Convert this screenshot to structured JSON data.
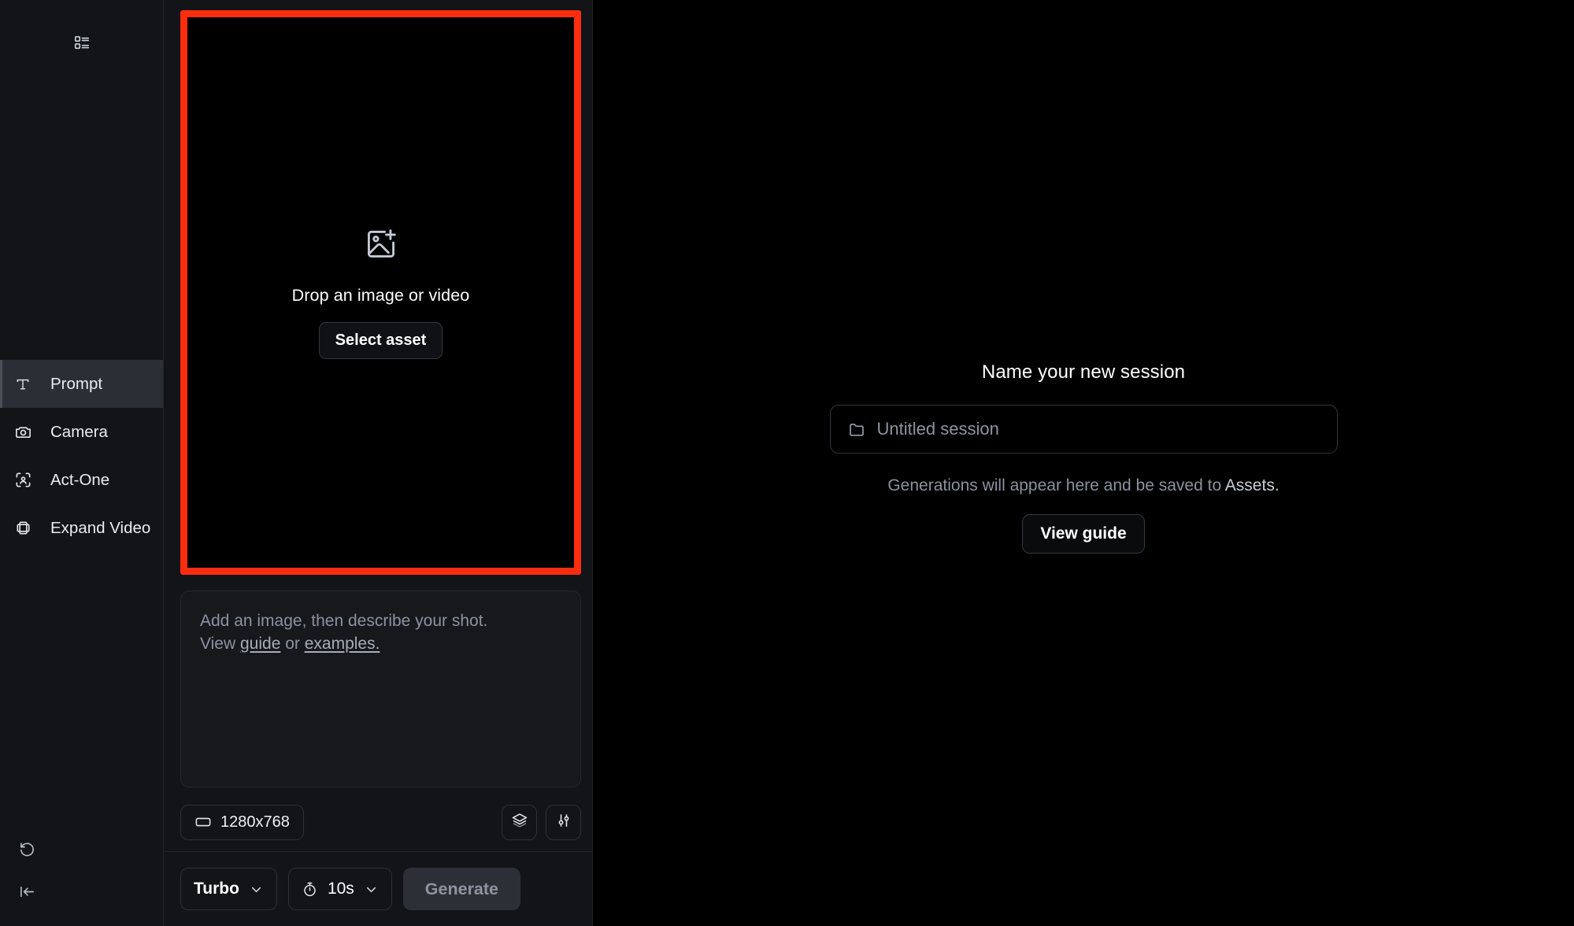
{
  "colors": {
    "highlight_ring": "#fa2d0e",
    "rail_bg": "#121418",
    "panel_bg": "#121418",
    "stage_bg": "#000000",
    "active_nav_bg": "#2b2e34"
  },
  "rail": {
    "top_icon": "list-view-icon",
    "nav_items": [
      {
        "label": "Prompt",
        "icon": "text-t-icon",
        "active": true
      },
      {
        "label": "Camera",
        "icon": "camera-icon",
        "active": false
      },
      {
        "label": "Act-One",
        "icon": "face-scan-icon",
        "active": false
      },
      {
        "label": "Expand Video",
        "icon": "expand-frames-icon",
        "active": false
      }
    ],
    "bottom_icons": [
      {
        "name": "history-reset-icon"
      },
      {
        "name": "collapse-panel-icon"
      }
    ]
  },
  "center": {
    "dropzone": {
      "icon": "image-plus-icon",
      "text": "Drop an image or video",
      "button_label": "Select asset",
      "highlighted": true
    },
    "prompt": {
      "placeholder_line1": "Add an image, then describe your shot.",
      "placeholder_line2_prefix": "View ",
      "link_guide": "guide",
      "placeholder_line2_mid": " or ",
      "link_examples": "examples.",
      "value": ""
    },
    "options": {
      "resolution_label": "1280x768",
      "resolution_icon": "aspect-ratio-icon",
      "layers_icon": "layers-icon",
      "settings_icon": "sliders-icon"
    },
    "generate_bar": {
      "model_label": "Turbo",
      "model_caret": "chevron-down-icon",
      "duration_label": "10s",
      "duration_icon": "stopwatch-icon",
      "duration_caret": "chevron-down-icon",
      "generate_label": "Generate",
      "generate_disabled": true
    }
  },
  "stage": {
    "title": "Name your new session",
    "session_input": {
      "icon": "folder-icon",
      "placeholder": "Untitled session",
      "value": ""
    },
    "note_prefix": "Generations will appear here and be saved to ",
    "note_assets": "Assets.",
    "view_guide_label": "View guide"
  }
}
